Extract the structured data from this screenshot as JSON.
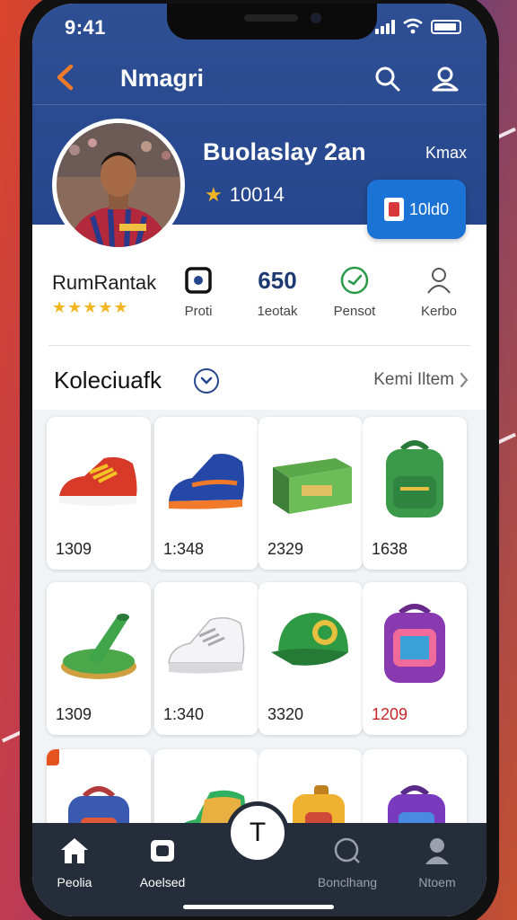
{
  "status": {
    "time": "9:41"
  },
  "header": {
    "title": "Nmagri"
  },
  "profile": {
    "name": "Buolaslay 2an",
    "score": "10014",
    "max_label": "Kmax",
    "action_label": "10ld0"
  },
  "rank": {
    "name": "RumRantak",
    "stars": "★★★★★"
  },
  "stats": [
    {
      "value": "",
      "label": "Proti",
      "icon": "square-dot-icon"
    },
    {
      "value": "650",
      "label": "1eotak",
      "icon": ""
    },
    {
      "value": "",
      "label": "Pensot",
      "icon": "check-circle-icon"
    },
    {
      "value": "",
      "label": "Kerbo",
      "icon": "person-icon"
    }
  ],
  "collection": {
    "title": "Koleciuafk",
    "view_all": "Kemi Iltem"
  },
  "items": [
    {
      "value": "1309",
      "icon": "red-sneaker-icon"
    },
    {
      "value": "1:348",
      "icon": "blue-cleat-icon"
    },
    {
      "value": "2329",
      "icon": "green-crate-icon"
    },
    {
      "value": "1638",
      "icon": "green-backpack-icon"
    },
    {
      "value": "1309",
      "icon": "green-trophy-icon"
    },
    {
      "value": "1:340",
      "icon": "white-sneaker-icon"
    },
    {
      "value": "3320",
      "icon": "green-cap-icon"
    },
    {
      "value": "1209",
      "icon": "purple-backpack-icon",
      "color": "#c62828"
    },
    {
      "value": "",
      "icon": "blue-backpack-icon"
    },
    {
      "value": "",
      "icon": "green-boot-icon"
    },
    {
      "value": "",
      "icon": "orange-backpack-icon"
    },
    {
      "value": "",
      "icon": "purple-bag-icon"
    }
  ],
  "nav": {
    "home": "Peolia",
    "second": "Aoelsed",
    "center": "T",
    "fourth": "Bonclhang",
    "fifth": "Ntoem"
  },
  "colors": {
    "primary": "#25468c",
    "accent": "#1b73d6",
    "star": "#f3b623",
    "nav": "#262d3a"
  }
}
